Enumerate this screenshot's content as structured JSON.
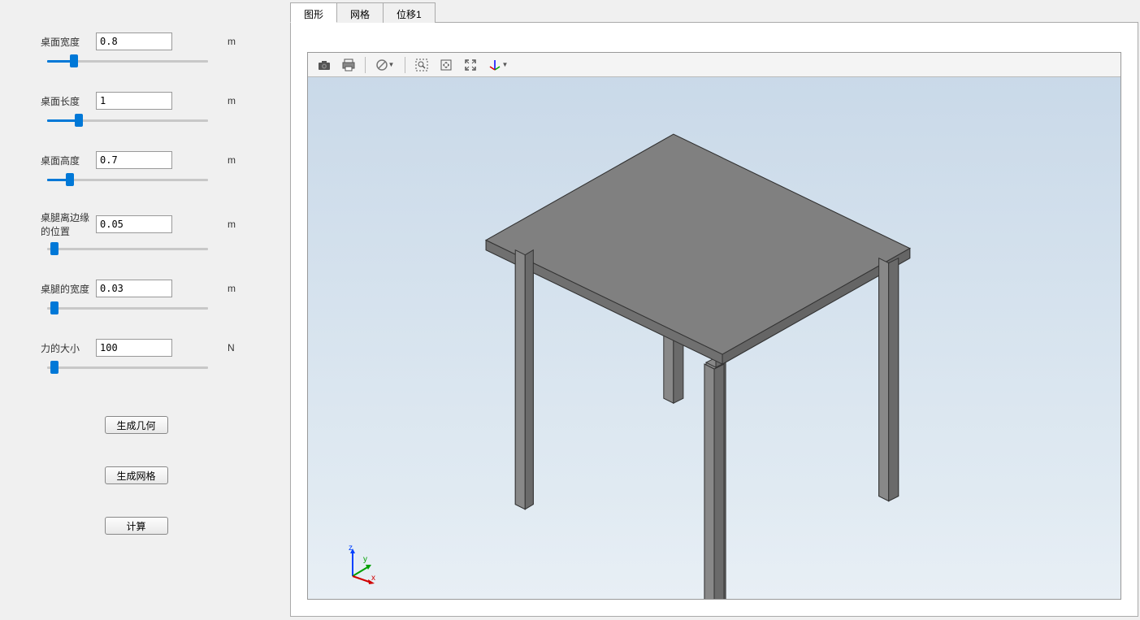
{
  "params": [
    {
      "label": "桌面宽度",
      "value": "0.8",
      "unit": "m",
      "fill": "15%"
    },
    {
      "label": "桌面长度",
      "value": "1",
      "unit": "m",
      "fill": "18%"
    },
    {
      "label": "桌面高度",
      "value": "0.7",
      "unit": "m",
      "fill": "12%"
    },
    {
      "label": "桌腿离边缘的位置",
      "value": "0.05",
      "unit": "m",
      "fill": "2%"
    },
    {
      "label": "桌腿的宽度",
      "value": "0.03",
      "unit": "m",
      "fill": "2%"
    },
    {
      "label": "力的大小",
      "value": "100",
      "unit": "N",
      "fill": "2%"
    }
  ],
  "buttons": {
    "gen_geometry": "生成几何",
    "gen_mesh": "生成网格",
    "calculate": "计算"
  },
  "tabs": [
    {
      "label": "图形",
      "active": true
    },
    {
      "label": "网格",
      "active": false
    },
    {
      "label": "位移1",
      "active": false
    }
  ],
  "axes": {
    "z": "z",
    "y": "y",
    "x": "x"
  },
  "toolbar_icons": [
    "camera-icon",
    "print-icon",
    "sep",
    "nosign-icon-dd",
    "sep",
    "zoom-box-icon",
    "pan-center-icon",
    "zoom-extents-icon",
    "axes-icon-dd"
  ]
}
